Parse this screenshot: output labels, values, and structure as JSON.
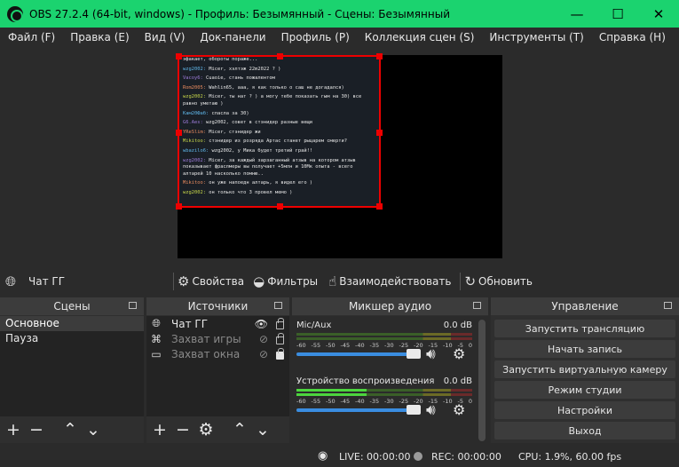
{
  "window": {
    "title": "OBS 27.2.4 (64-bit, windows) - Профиль: Безымянный - Сцены: Безымянный",
    "minimize_glyph": "—",
    "maximize_glyph": "☐",
    "close_glyph": "✕",
    "accent": "#1bd36f"
  },
  "menu": [
    "Файл (F)",
    "Правка (E)",
    "Вид (V)",
    "Док-панели",
    "Профиль (P)",
    "Коллекция сцен (S)",
    "Инструменты (T)",
    "Справка (H)"
  ],
  "chat": {
    "lines": [
      {
        "user": "",
        "text": "эфакает, обороты пораже..."
      },
      {
        "user": "wzg2002:",
        "text": " Micer, хэлтэж 22m2022 ? )"
      },
      {
        "user": "Vacoy6:",
        "text": " Cuaoie, стань пожалентом"
      },
      {
        "user": "Rom2005:",
        "text": " Wahlin65, ааа, я как только о саш не догадался)"
      },
      {
        "user": "wzg2002:",
        "text": " Micer, ты нат ? ) а могу тебе показать гым на 30) все равно уметаю )"
      },
      {
        "user": "Кам20Фаб:",
        "text": " спасла за 30)"
      },
      {
        "user": "G6.Aes:",
        "text": " wzg2002, совет в стэнидер разные вещи"
      },
      {
        "user": "YReSlim:",
        "text": " Micer, стэнидер жи"
      },
      {
        "user": "Mikitoo:",
        "text": " стэнидер из розряда Артас станет рыцарем смерти?"
      },
      {
        "user": "wbazilo6:",
        "text": " wzg2002, у Мика будет третий грай!!"
      },
      {
        "user": "wzg2002:",
        "text": " Micer, за каждый зарзаганный атзыв на котором атзыв показывает фраслмеры вы получает +5млн и 10Мк опыта - всего алтарей 10 насколько помню.."
      },
      {
        "user": "Mikitoo:",
        "text": " он уже напоедн алтарь, я видел его )"
      },
      {
        "user": "wzg2002:",
        "text": " он только что 3 провел мемо )"
      }
    ]
  },
  "source_toolbar": {
    "source_name": "Чат ГГ",
    "buttons": [
      {
        "icon": "gear-icon",
        "label": "Свойства"
      },
      {
        "icon": "filter-icon",
        "label": "Фильтры"
      },
      {
        "icon": "hand-icon",
        "label": "Взаимодействовать"
      },
      {
        "icon": "refresh-icon",
        "label": "Обновить"
      }
    ]
  },
  "scenes": {
    "title": "Сцены",
    "items": [
      "Основное",
      "Пауза"
    ],
    "selected": "Основное"
  },
  "sources": {
    "title": "Источники",
    "items": [
      {
        "name": "Чат ГГ",
        "icon": "globe-icon",
        "visible": true,
        "locked": false
      },
      {
        "name": "Захват игры",
        "icon": "gamepad-icon",
        "visible": false,
        "locked": false
      },
      {
        "name": "Захват окна",
        "icon": "window-icon",
        "visible": false,
        "locked": true
      }
    ]
  },
  "mixer": {
    "title": "Микшер аудио",
    "ticks": [
      "-60",
      "-55",
      "-50",
      "-45",
      "-40",
      "-35",
      "-30",
      "-25",
      "-20",
      "-15",
      "-10",
      "-5",
      "0"
    ],
    "channels": [
      {
        "name": "Mic/Aux",
        "db": "0.0 dB",
        "volume": 1.0,
        "active": false
      },
      {
        "name": "Устройство воспроизведения",
        "db": "0.0 dB",
        "volume": 1.0,
        "active": true
      }
    ]
  },
  "controls": {
    "title": "Управление",
    "buttons": [
      "Запустить трансляцию",
      "Начать запись",
      "Запустить виртуальную камеру",
      "Режим студии",
      "Настройки",
      "Выход"
    ]
  },
  "status": {
    "live": "LIVE: 00:00:00",
    "rec": "REC: 00:00:00",
    "cpu": "CPU: 1.9%, 60.00 fps"
  }
}
